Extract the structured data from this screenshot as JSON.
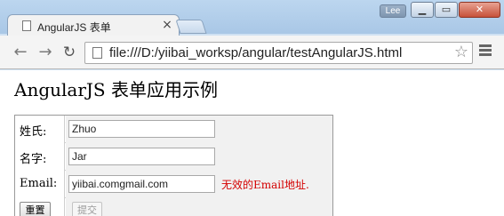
{
  "browser": {
    "tab_title": "AngularJS 表单",
    "tab_close": "×",
    "user_name": "Lee",
    "window_controls": {
      "minimize": "▁",
      "maximize": "▭",
      "close": "✕"
    },
    "url": "file:///D:/yiibai_worksp/angular/testAngularJS.html"
  },
  "page": {
    "title": "AngularJS 表单应用示例",
    "form": {
      "last_name_label": "姓氏:",
      "last_name_value": "Zhuo",
      "first_name_label": "名字:",
      "first_name_value": "Jar",
      "email_label": "Email:",
      "email_value": "yiibai.comgmail.com",
      "email_error": "无效的Email地址.",
      "reset_label": "重置",
      "submit_label": "提交"
    }
  },
  "colors": {
    "error": "#d40000",
    "chrome_frame": "#bcd6ef"
  }
}
